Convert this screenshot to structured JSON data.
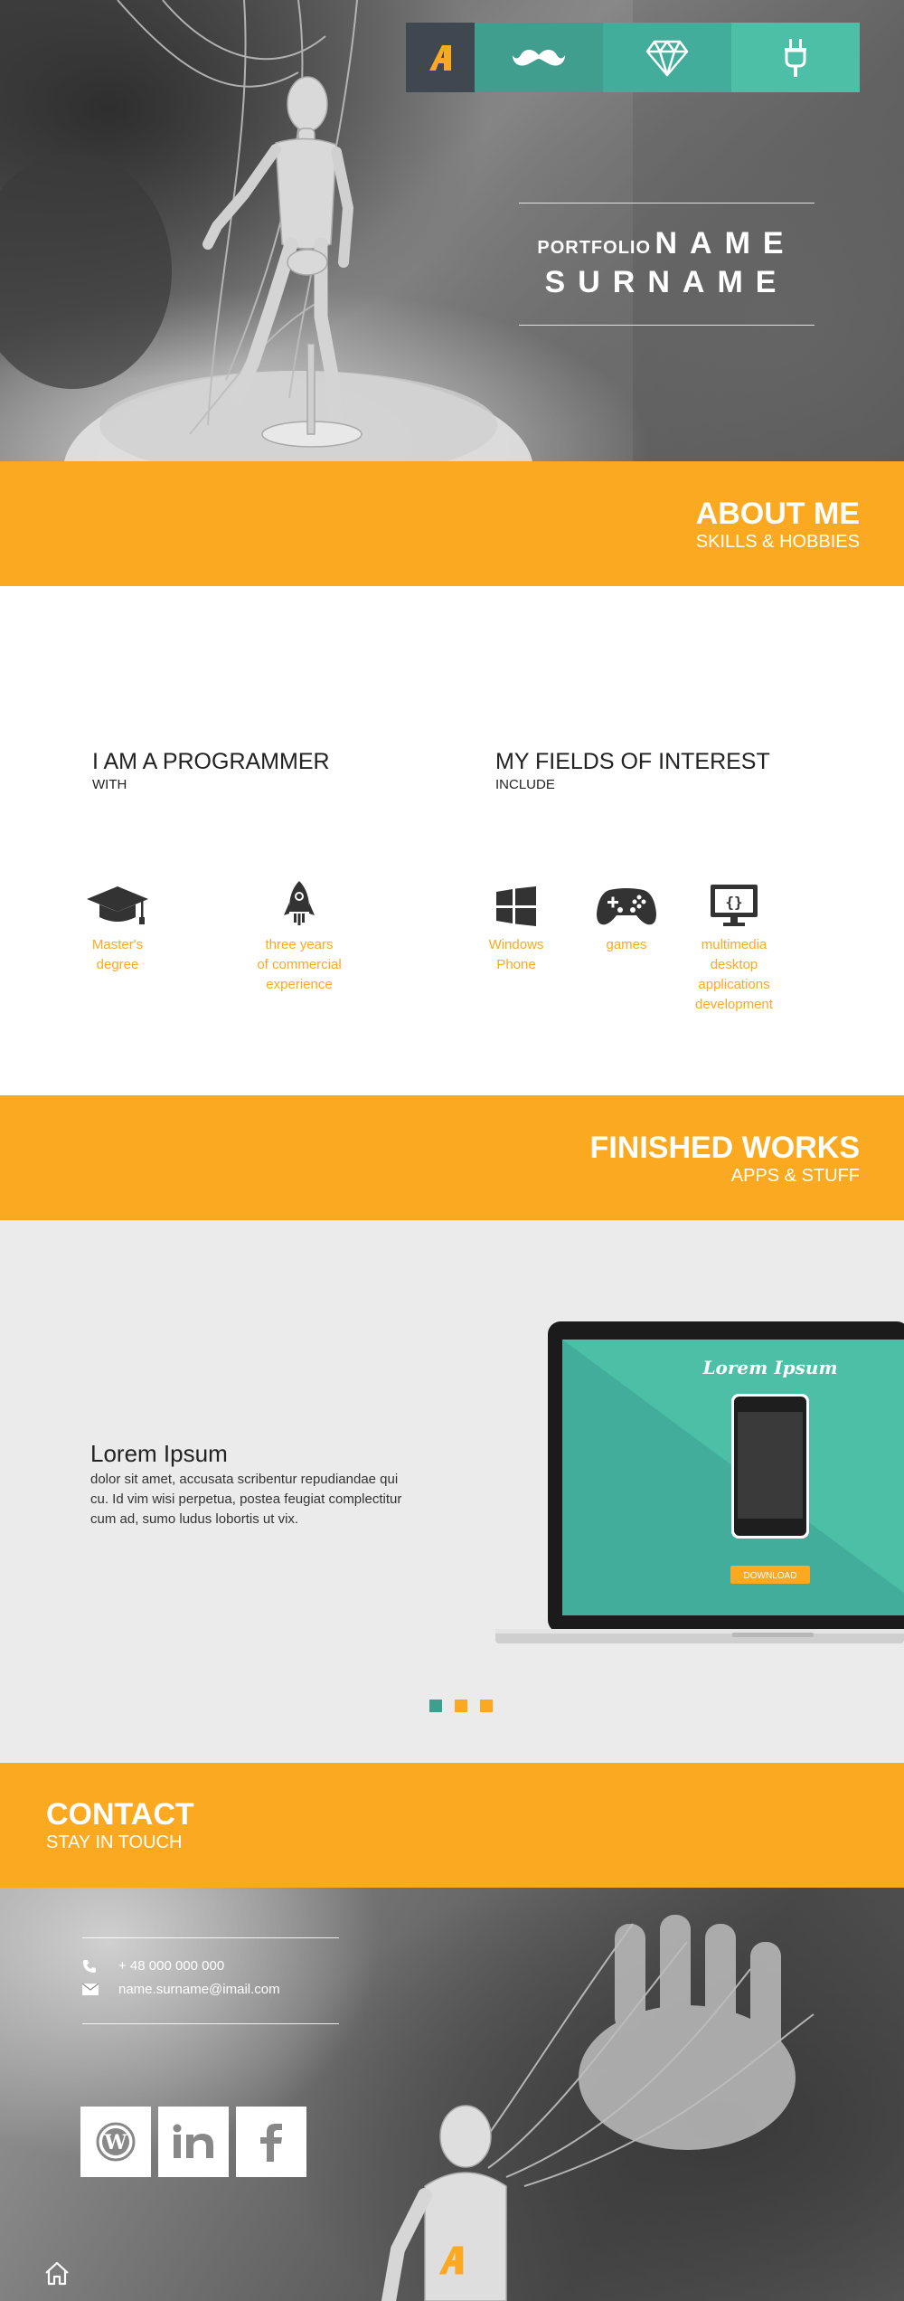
{
  "nav": {
    "items": [
      "logo",
      "mustache",
      "diamond",
      "plug"
    ],
    "logo_color": "#fba920"
  },
  "hero": {
    "portfolio_label": "PORTFOLIO",
    "name": "NAME",
    "surname": "SURNAME"
  },
  "about_band": {
    "title": "ABOUT ME",
    "subtitle": "SKILLS & HOBBIES"
  },
  "about": {
    "programmer": {
      "heading": "I AM A PROGRAMMER",
      "subheading": "WITH",
      "skills": [
        {
          "icon": "graduation-cap-icon",
          "line1": "Master's",
          "line2": "degree"
        },
        {
          "icon": "rocket-icon",
          "line1": "three years",
          "line2": "of commercial",
          "line3": "experience"
        }
      ]
    },
    "interests": {
      "heading": "MY FIELDS OF INTEREST",
      "subheading": "INCLUDE",
      "items": [
        {
          "icon": "windows-icon",
          "line1": "Windows",
          "line2": "Phone"
        },
        {
          "icon": "gamepad-icon",
          "line1": "games"
        },
        {
          "icon": "code-monitor-icon",
          "line1": "multimedia",
          "line2": "desktop",
          "line3": "applications",
          "line4": "development"
        }
      ]
    }
  },
  "works_band": {
    "title": "FINISHED WORKS",
    "subtitle": "APPS & STUFF"
  },
  "works": {
    "title": "Lorem Ipsum",
    "description": "dolor sit amet, accusata scribentur repudiandae qui cu. Id vim wisi perpetua, postea feugiat complectitur cum ad, sumo ludus lobortis ut vix.",
    "screen_title": "Lorem Ipsum",
    "download_label": "DOWNLOAD",
    "dot_colors": [
      "#3f9e8e",
      "#fba920",
      "#fba920"
    ]
  },
  "contact_band": {
    "title": "CONTACT",
    "subtitle": "STAY IN TOUCH"
  },
  "contact": {
    "phone": "+ 48 000 000 000",
    "email": "name.surname@imail.com",
    "social": [
      "wordpress-icon",
      "linkedin-icon",
      "facebook-icon"
    ]
  },
  "colors": {
    "accent": "#fba920",
    "teal": "#43ad9b",
    "dark": "#3f4750"
  }
}
